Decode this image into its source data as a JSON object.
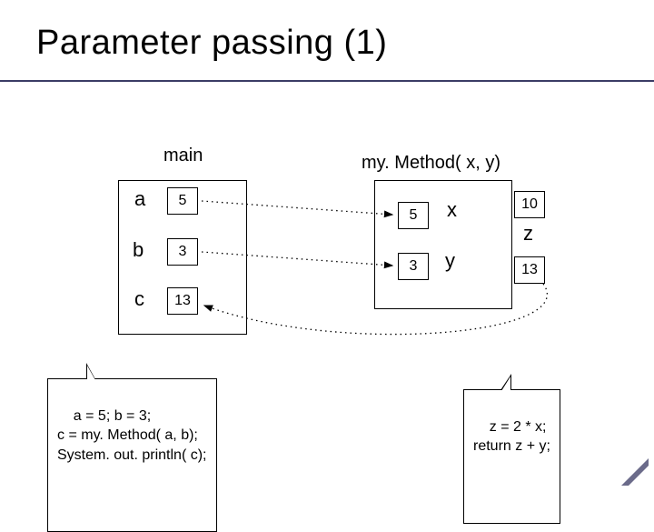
{
  "title": "Parameter passing (1)",
  "columns": {
    "main": "main",
    "method": "my. Method( x, y)"
  },
  "main_vars": {
    "a": {
      "label": "a",
      "value": "5"
    },
    "b": {
      "label": "b",
      "value": "3"
    },
    "c": {
      "label": "c",
      "value": "13"
    }
  },
  "method_vars": {
    "x": {
      "label": "x",
      "value": "5"
    },
    "y": {
      "label": "y",
      "value": "3"
    },
    "z": {
      "label": "z",
      "value": "10"
    },
    "ret": {
      "value": "13"
    }
  },
  "code_left": "a = 5; b = 3;\nc = my. Method( a, b);\nSystem. out. println( c);",
  "code_right": "z = 2 * x;\nreturn z + y;"
}
